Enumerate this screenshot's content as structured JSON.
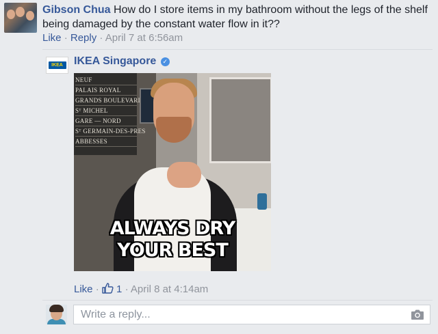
{
  "comment": {
    "author": "Gibson Chua",
    "text": "How do I store items in my bathroom without the legs of the shelf being damaged by the constant water flow in it??",
    "like_label": "Like",
    "reply_label": "Reply",
    "timestamp": "April 7 at 6:56am",
    "avatar_icon": "group-photo-avatar"
  },
  "reply": {
    "author": "IKEA Singapore",
    "logo_text": "IKEA",
    "verified_icon": "verified-badge-icon",
    "image": {
      "sign_lines": [
        "NEUF",
        "PALAIS ROYAL",
        "GRANDS BOULEVARDS",
        "Sᵀ MICHEL",
        "GARE — NORD",
        "Sᵀ GERMAIN-DES-PRES",
        "ABBESSES"
      ],
      "caption_line1": "ALWAYS DRY",
      "caption_line2": "YOUR BEST"
    },
    "like_label": "Like",
    "like_count": "1",
    "timestamp": "April 8 at 4:14am"
  },
  "reply_box": {
    "placeholder": "Write a reply...",
    "camera_icon": "camera-icon"
  },
  "colors": {
    "link": "#365899",
    "meta": "#90949c",
    "background": "#e9ebee"
  }
}
